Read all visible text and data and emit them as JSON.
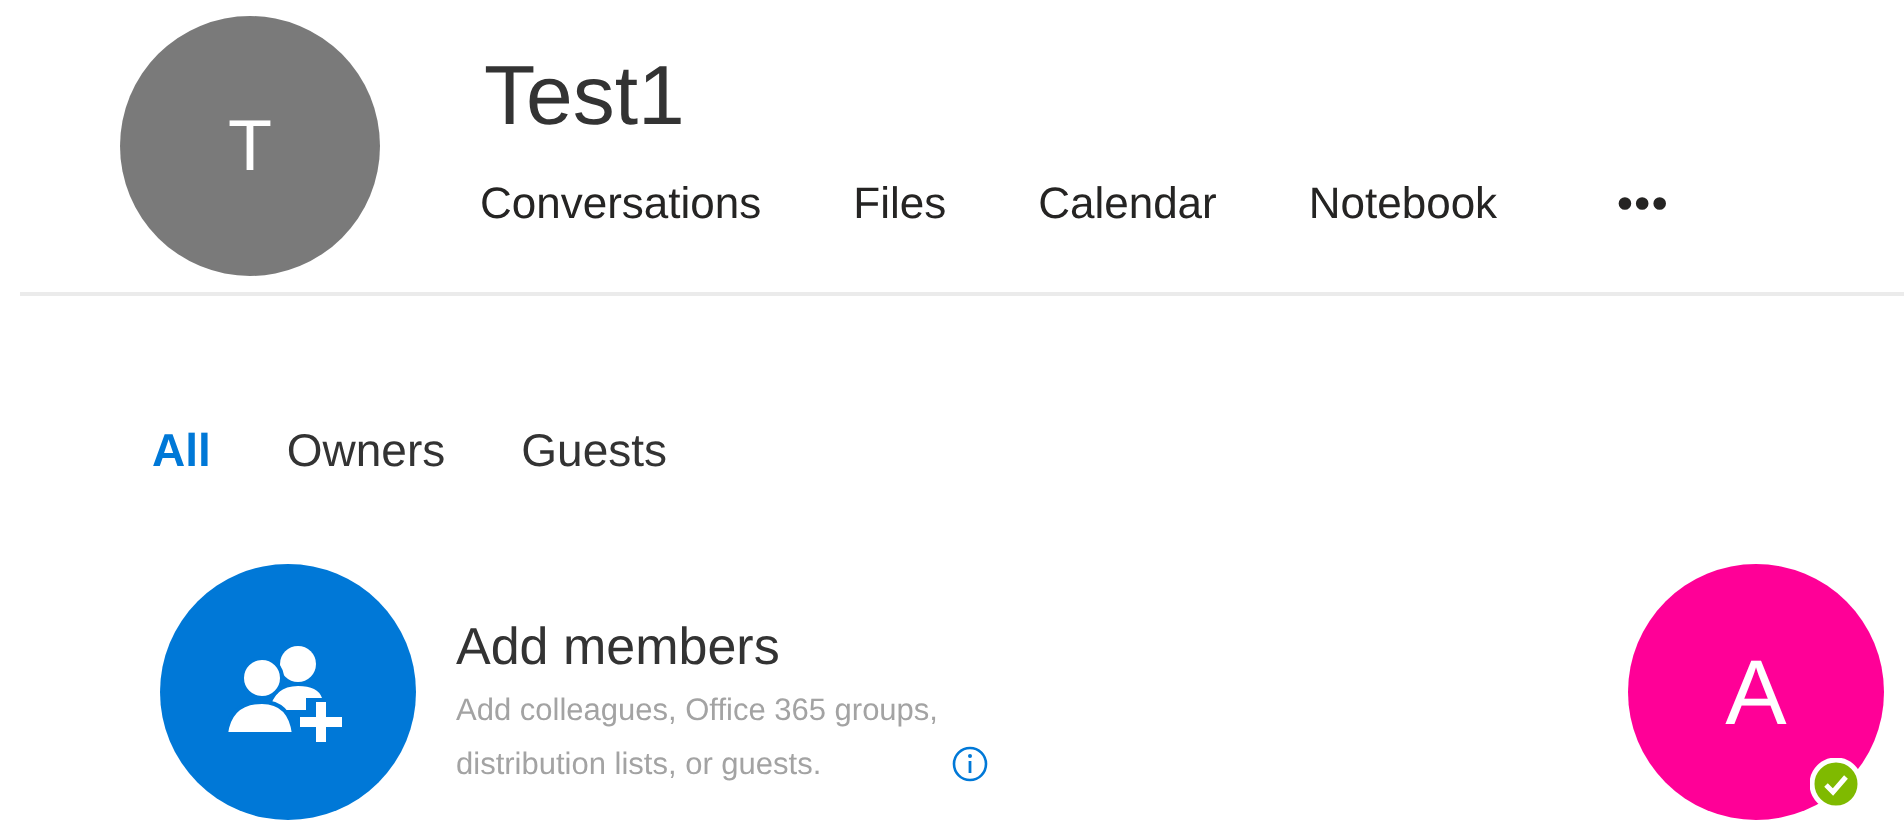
{
  "group": {
    "initial": "T",
    "name": "Test1"
  },
  "nav_tabs": [
    {
      "label": "Conversations"
    },
    {
      "label": "Files"
    },
    {
      "label": "Calendar"
    },
    {
      "label": "Notebook"
    },
    {
      "label": "•••"
    }
  ],
  "filter_tabs": [
    {
      "label": "All",
      "selected": true
    },
    {
      "label": "Owners",
      "selected": false
    },
    {
      "label": "Guests",
      "selected": false
    }
  ],
  "add_members": {
    "title": "Add members",
    "description": "Add colleagues, Office 365 groups, distribution lists, or guests."
  },
  "members": [
    {
      "initial": "A",
      "color": "#ff0097",
      "online": true
    }
  ]
}
